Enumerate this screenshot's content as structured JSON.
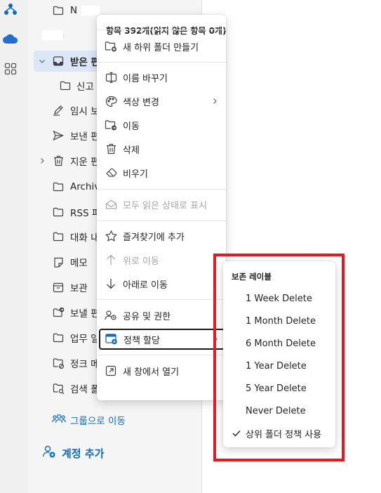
{
  "rail": {
    "icons": [
      "org-chart-icon",
      "cloud-icon",
      "apps-grid-icon"
    ]
  },
  "folders": [
    {
      "label": "N",
      "icon": "folder-icon",
      "redacted": true
    },
    {
      "label": "",
      "icon": "folder-icon",
      "redacted": true
    },
    {
      "label": "받은 편",
      "icon": "inbox-icon",
      "expanded": true,
      "selected": true
    },
    {
      "label": "신고",
      "icon": "folder-icon",
      "sub": true
    },
    {
      "label": "임시 보",
      "icon": "draft-pencil-icon"
    },
    {
      "label": "보낸 편",
      "icon": "send-icon"
    },
    {
      "label": "지운 편",
      "icon": "trash-icon",
      "collapsed": true
    },
    {
      "label": "Archive",
      "icon": "folder-icon"
    },
    {
      "label": "RSS 피",
      "icon": "folder-icon"
    },
    {
      "label": "대화 내",
      "icon": "folder-icon"
    },
    {
      "label": "메모",
      "icon": "note-icon"
    },
    {
      "label": "보관",
      "icon": "archive-box-icon"
    },
    {
      "label": "보낼 편",
      "icon": "outbox-icon"
    },
    {
      "label": "업무 일",
      "icon": "folder-icon"
    },
    {
      "label": "정크 메",
      "icon": "junk-folder-icon"
    },
    {
      "label": "검색 폴",
      "icon": "search-folder-icon"
    }
  ],
  "group_link": {
    "label": "그룹으로 이동"
  },
  "account_add": {
    "label": "계정 추가"
  },
  "context_menu": {
    "header": "항목 392개(읽지 않은 항목 0개)",
    "items": [
      {
        "label": "새 하위 폴더 만들기",
        "icon": "new-folder-icon"
      },
      {
        "label": "이름 바꾸기",
        "icon": "rename-icon"
      },
      {
        "label": "색상 변경",
        "icon": "palette-icon",
        "has_submenu": true
      },
      {
        "label": "이동",
        "icon": "move-folder-icon"
      },
      {
        "label": "삭제",
        "icon": "delete-icon"
      },
      {
        "label": "비우기",
        "icon": "empty-icon"
      },
      {
        "label": "모두 읽은 상태로 표시",
        "icon": "mark-read-icon",
        "disabled": true
      },
      {
        "label": "즐겨찾기에 추가",
        "icon": "star-icon"
      },
      {
        "label": "위로 이동",
        "icon": "arrow-up-icon",
        "disabled": true
      },
      {
        "label": "아래로 이동",
        "icon": "arrow-down-icon"
      },
      {
        "label": "공유 및 권한",
        "icon": "share-people-icon"
      },
      {
        "label": "정책 할당",
        "icon": "policy-icon",
        "has_submenu": true,
        "focused": true
      },
      {
        "label": "새 창에서 열기",
        "icon": "open-new-window-icon"
      }
    ]
  },
  "retention_submenu": {
    "header": "보존 레이블",
    "items": [
      {
        "label": "1 Week Delete"
      },
      {
        "label": "1 Month Delete"
      },
      {
        "label": "6 Month Delete"
      },
      {
        "label": "1 Year Delete"
      },
      {
        "label": "5 Year Delete"
      },
      {
        "label": "Never Delete"
      },
      {
        "label": "상위 폴더 정책 사용",
        "checked": true
      }
    ]
  },
  "colors": {
    "accent": "#0f6cbd",
    "selected_bg": "#dbe6f7",
    "highlight": "#e01b24",
    "policy_icon": "#0f6cbd"
  }
}
